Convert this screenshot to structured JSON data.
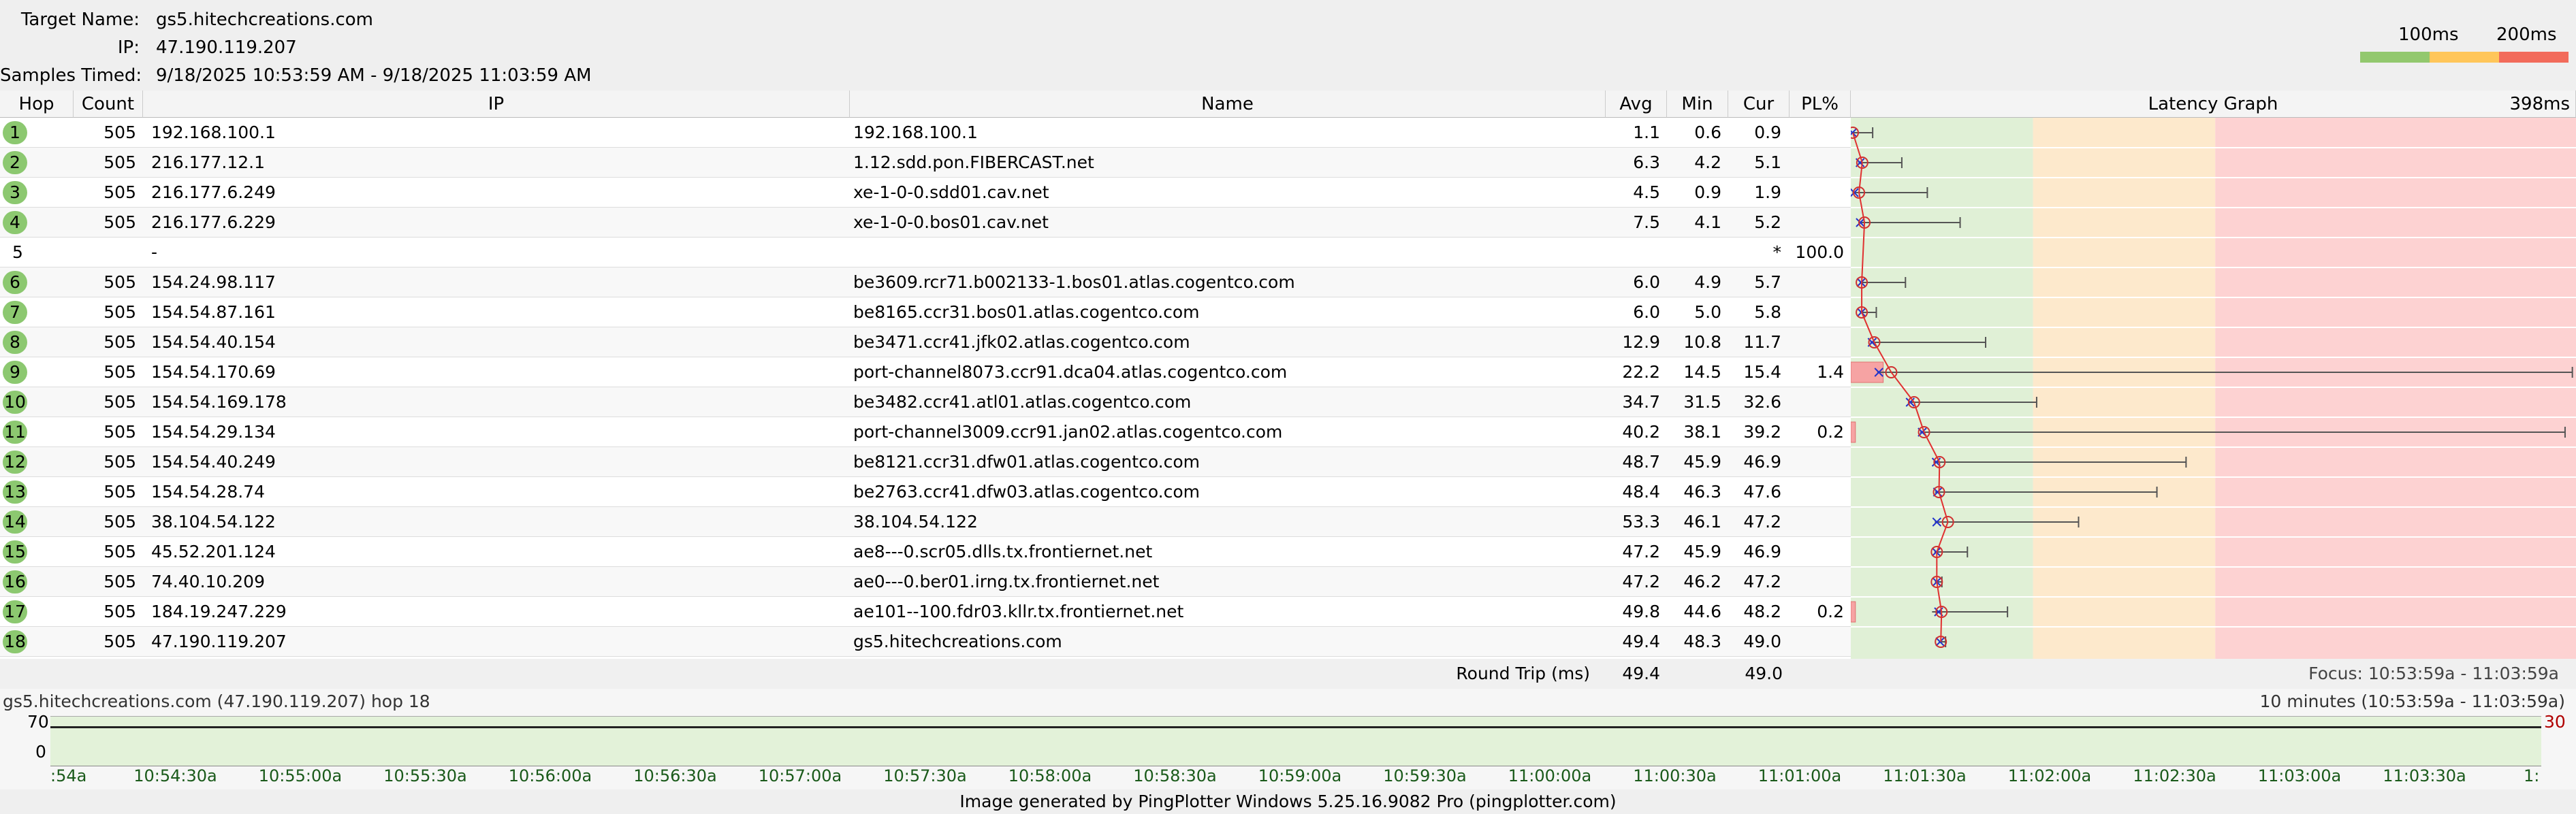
{
  "header": {
    "target_label": "Target Name:",
    "target_value": "gs5.hitechcreations.com",
    "ip_label": "IP:",
    "ip_value": "47.190.119.207",
    "samples_label": "Samples Timed:",
    "samples_value": "9/18/2025 10:53:59 AM - 9/18/2025 11:03:59 AM"
  },
  "legend": {
    "label_100": "100ms",
    "label_200": "200ms",
    "colors": [
      "#92c86e",
      "#ffc65a",
      "#f26b5b"
    ]
  },
  "columns": {
    "hop": "Hop",
    "count": "Count",
    "ip": "IP",
    "name": "Name",
    "avg": "Avg",
    "min": "Min",
    "cur": "Cur",
    "pl": "PL%",
    "graph": "Latency Graph",
    "graph_max": "398ms"
  },
  "hops": [
    {
      "hop": "1",
      "count": "505",
      "ip": "192.168.100.1",
      "name": "192.168.100.1",
      "avg": "1.1",
      "min": "0.6",
      "cur": "0.9",
      "pl": "",
      "max": 12
    },
    {
      "hop": "2",
      "count": "505",
      "ip": "216.177.12.1",
      "name": "1.12.sdd.pon.FIBERCAST.net",
      "avg": "6.3",
      "min": "4.2",
      "cur": "5.1",
      "pl": "",
      "max": 28
    },
    {
      "hop": "3",
      "count": "505",
      "ip": "216.177.6.249",
      "name": "xe-1-0-0.sdd01.cav.net",
      "avg": "4.5",
      "min": "0.9",
      "cur": "1.9",
      "pl": "",
      "max": 42
    },
    {
      "hop": "4",
      "count": "505",
      "ip": "216.177.6.229",
      "name": "xe-1-0-0.bos01.cav.net",
      "avg": "7.5",
      "min": "4.1",
      "cur": "5.2",
      "pl": "",
      "max": 60
    },
    {
      "hop": "5",
      "count": "",
      "ip": "-",
      "name": "",
      "avg": "",
      "min": "",
      "cur": "*",
      "pl": "100.0",
      "max": null
    },
    {
      "hop": "6",
      "count": "505",
      "ip": "154.24.98.117",
      "name": "be3609.rcr71.b002133-1.bos01.atlas.cogentco.com",
      "avg": "6.0",
      "min": "4.9",
      "cur": "5.7",
      "pl": "",
      "max": 30
    },
    {
      "hop": "7",
      "count": "505",
      "ip": "154.54.87.161",
      "name": "be8165.ccr31.bos01.atlas.cogentco.com",
      "avg": "6.0",
      "min": "5.0",
      "cur": "5.8",
      "pl": "",
      "max": 14
    },
    {
      "hop": "8",
      "count": "505",
      "ip": "154.54.40.154",
      "name": "be3471.ccr41.jfk02.atlas.cogentco.com",
      "avg": "12.9",
      "min": "10.8",
      "cur": "11.7",
      "pl": "",
      "max": 74
    },
    {
      "hop": "9",
      "count": "505",
      "ip": "154.54.170.69",
      "name": "port-channel8073.ccr91.dca04.atlas.cogentco.com",
      "avg": "22.2",
      "min": "14.5",
      "cur": "15.4",
      "pl": "1.4",
      "max": 396
    },
    {
      "hop": "10",
      "count": "505",
      "ip": "154.54.169.178",
      "name": "be3482.ccr41.atl01.atlas.cogentco.com",
      "avg": "34.7",
      "min": "31.5",
      "cur": "32.6",
      "pl": "",
      "max": 102
    },
    {
      "hop": "11",
      "count": "505",
      "ip": "154.54.29.134",
      "name": "port-channel3009.ccr91.jan02.atlas.cogentco.com",
      "avg": "40.2",
      "min": "38.1",
      "cur": "39.2",
      "pl": "0.2",
      "max": 392
    },
    {
      "hop": "12",
      "count": "505",
      "ip": "154.54.40.249",
      "name": "be8121.ccr31.dfw01.atlas.cogentco.com",
      "avg": "48.7",
      "min": "45.9",
      "cur": "46.9",
      "pl": "",
      "max": 184
    },
    {
      "hop": "13",
      "count": "505",
      "ip": "154.54.28.74",
      "name": "be2763.ccr41.dfw03.atlas.cogentco.com",
      "avg": "48.4",
      "min": "46.3",
      "cur": "47.6",
      "pl": "",
      "max": 168
    },
    {
      "hop": "14",
      "count": "505",
      "ip": "38.104.54.122",
      "name": "38.104.54.122",
      "avg": "53.3",
      "min": "46.1",
      "cur": "47.2",
      "pl": "",
      "max": 125
    },
    {
      "hop": "15",
      "count": "505",
      "ip": "45.52.201.124",
      "name": "ae8---0.scr05.dlls.tx.frontiernet.net",
      "avg": "47.2",
      "min": "45.9",
      "cur": "46.9",
      "pl": "",
      "max": 64
    },
    {
      "hop": "16",
      "count": "505",
      "ip": "74.40.10.209",
      "name": "ae0---0.ber01.irng.tx.frontiernet.net",
      "avg": "47.2",
      "min": "46.2",
      "cur": "47.2",
      "pl": "",
      "max": 50
    },
    {
      "hop": "17",
      "count": "505",
      "ip": "184.19.247.229",
      "name": "ae101--100.fdr03.kllr.tx.frontiernet.net",
      "avg": "49.8",
      "min": "44.6",
      "cur": "48.2",
      "pl": "0.2",
      "max": 86
    },
    {
      "hop": "18",
      "count": "505",
      "ip": "47.190.119.207",
      "name": "gs5.hitechcreations.com",
      "avg": "49.4",
      "min": "48.3",
      "cur": "49.0",
      "pl": "",
      "max": 52
    }
  ],
  "round_trip": {
    "label": "Round Trip (ms)",
    "avg": "49.4",
    "cur": "49.0",
    "focus": "Focus: 10:53:59a - 11:03:59a"
  },
  "timeline": {
    "title": "gs5.hitechcreations.com (47.190.119.207) hop 18",
    "range": "10 minutes (10:53:59a - 11:03:59a)",
    "y_top": "70",
    "y_bottom": "0",
    "right_value": "30",
    "ticks": [
      ":54a",
      "10:54:30a",
      "10:55:00a",
      "10:55:30a",
      "10:56:00a",
      "10:56:30a",
      "10:57:00a",
      "10:57:30a",
      "10:58:00a",
      "10:58:30a",
      "10:59:00a",
      "10:59:30a",
      "11:00:00a",
      "11:00:30a",
      "11:01:00a",
      "11:01:30a",
      "11:02:00a",
      "11:02:30a",
      "11:03:00a",
      "11:03:30a",
      "1:"
    ]
  },
  "footer": "Image generated by PingPlotter Windows 5.25.16.9082 Pro (pingplotter.com)"
}
